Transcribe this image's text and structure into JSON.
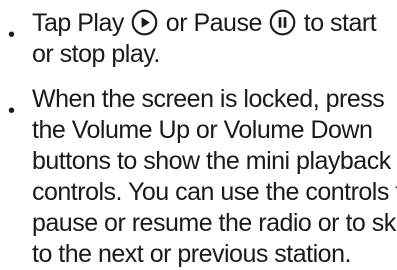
{
  "bullets": [
    {
      "marker": "•",
      "line1_part1": "Tap Play ",
      "play_icon": "play-circle-icon",
      "line1_part2": " or Pause ",
      "pause_icon": "pause-circle-icon",
      "line1_part3": " to start",
      "line2": "or stop play."
    },
    {
      "marker": "•",
      "lines": [
        "When the screen is locked, press",
        "the Volume Up or Volume Down",
        "buttons to show the mini playback",
        "controls. You can use the controls to",
        "pause or resume the radio or to skip",
        "to the next or previous station."
      ]
    }
  ]
}
